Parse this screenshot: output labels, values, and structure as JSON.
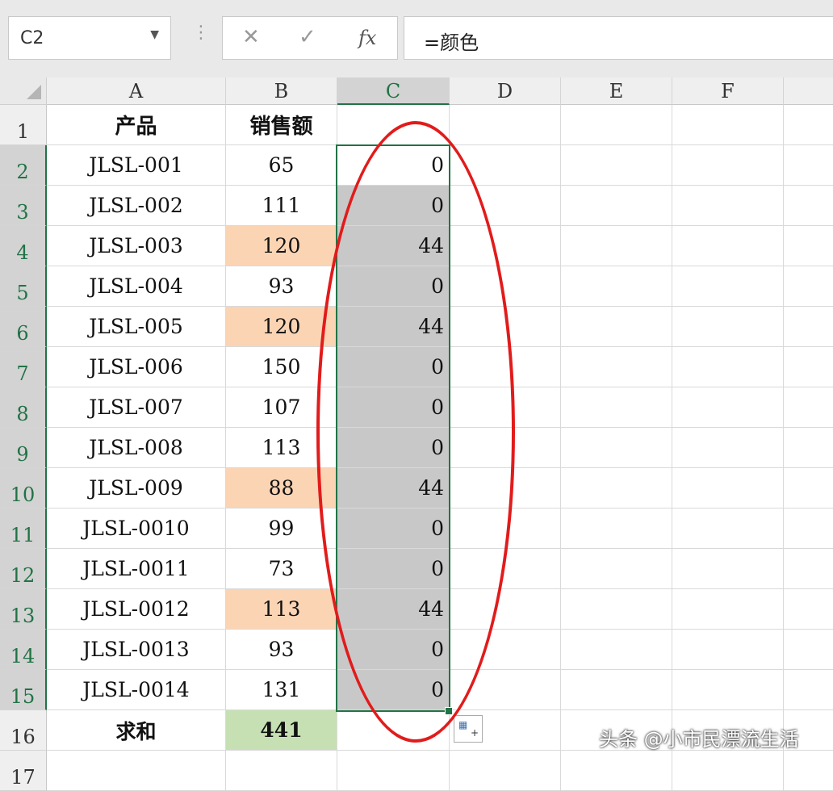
{
  "namebox": {
    "value": "C2"
  },
  "formula_bar": {
    "cancel_icon": "✕",
    "enter_icon": "✓",
    "fx_label": "fx",
    "formula": "=颜色"
  },
  "columns": [
    "A",
    "B",
    "C",
    "D",
    "E",
    "F"
  ],
  "rows": [
    "1",
    "2",
    "3",
    "4",
    "5",
    "6",
    "7",
    "8",
    "9",
    "10",
    "11",
    "12",
    "13",
    "14",
    "15",
    "16",
    "17"
  ],
  "header": {
    "a": "产品",
    "b": "销售额"
  },
  "data": [
    {
      "product": "JLSL-001",
      "sales": "65",
      "c": "0",
      "orange": false
    },
    {
      "product": "JLSL-002",
      "sales": "111",
      "c": "0",
      "orange": false
    },
    {
      "product": "JLSL-003",
      "sales": "120",
      "c": "44",
      "orange": true
    },
    {
      "product": "JLSL-004",
      "sales": "93",
      "c": "0",
      "orange": false
    },
    {
      "product": "JLSL-005",
      "sales": "120",
      "c": "44",
      "orange": true
    },
    {
      "product": "JLSL-006",
      "sales": "150",
      "c": "0",
      "orange": false
    },
    {
      "product": "JLSL-007",
      "sales": "107",
      "c": "0",
      "orange": false
    },
    {
      "product": "JLSL-008",
      "sales": "113",
      "c": "0",
      "orange": false
    },
    {
      "product": "JLSL-009",
      "sales": "88",
      "c": "44",
      "orange": true
    },
    {
      "product": "JLSL-0010",
      "sales": "99",
      "c": "0",
      "orange": false
    },
    {
      "product": "JLSL-0011",
      "sales": "73",
      "c": "0",
      "orange": false
    },
    {
      "product": "JLSL-0012",
      "sales": "113",
      "c": "44",
      "orange": true
    },
    {
      "product": "JLSL-0013",
      "sales": "93",
      "c": "0",
      "orange": false
    },
    {
      "product": "JLSL-0014",
      "sales": "131",
      "c": "0",
      "orange": false
    }
  ],
  "total": {
    "label": "求和",
    "value": "441"
  },
  "watermark": "头条 @小市民漂流生活",
  "colors": {
    "selection": "#217346",
    "orange_fill": "#fbd4b4",
    "green_fill": "#c6e0b4",
    "gray_fill": "#c8c8c8",
    "annotation": "#e21b1b"
  }
}
